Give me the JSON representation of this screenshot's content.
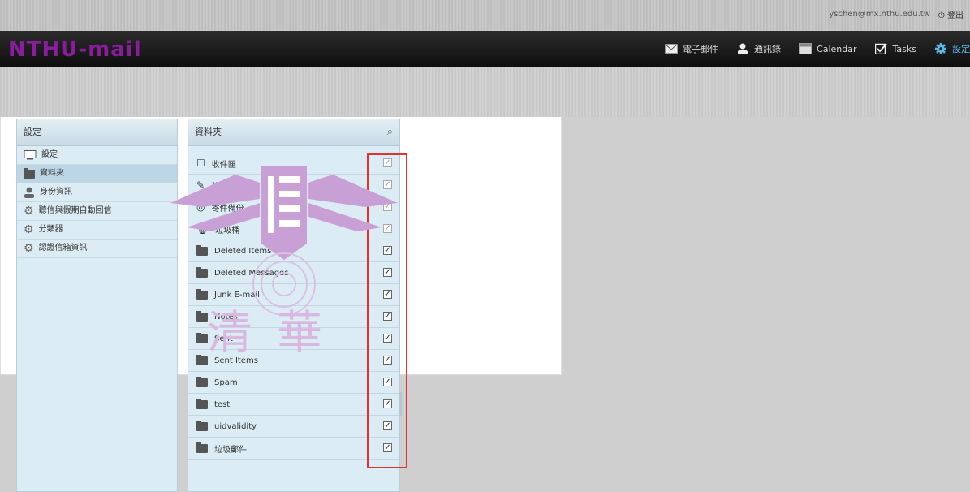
{
  "topstrip": {
    "user_email": "yschen@mx.nthu.edu.tw",
    "logout_label": "登出"
  },
  "header": {
    "logo": "NTHU-mail"
  },
  "nav": [
    {
      "label": "電子郵件",
      "icon": "envelope-icon"
    },
    {
      "label": "通訊錄",
      "icon": "person-icon"
    },
    {
      "label": "Calendar",
      "icon": "calendar-icon"
    },
    {
      "label": "Tasks",
      "icon": "checkbox-icon"
    },
    {
      "label": "設定",
      "icon": "gear-icon"
    }
  ],
  "settings": {
    "title": "設定",
    "items": [
      {
        "label": "設定",
        "icon": "monitor-icon"
      },
      {
        "label": "資料夾",
        "icon": "folder-icon"
      },
      {
        "label": "身份資訊",
        "icon": "person-icon"
      },
      {
        "label": "聽信與假期自動回信",
        "icon": "gear-icon"
      },
      {
        "label": "分類器",
        "icon": "gear-icon"
      },
      {
        "label": "認證信箱資訊",
        "icon": "gear-icon"
      }
    ]
  },
  "folders": {
    "title": "資料夾",
    "items": [
      {
        "label": "收件匣",
        "icon": "inbox-icon",
        "checked": true,
        "locked": true
      },
      {
        "label": "草稿匣",
        "icon": "pencil-icon",
        "checked": true,
        "locked": true
      },
      {
        "label": "寄件備份",
        "icon": "sent-icon",
        "checked": true,
        "locked": true
      },
      {
        "label": "垃圾桶",
        "icon": "trash-icon",
        "checked": true,
        "locked": true
      },
      {
        "label": "Deleted Items",
        "icon": "folder-icon",
        "checked": true,
        "locked": false
      },
      {
        "label": "Deleted Messages",
        "icon": "folder-icon",
        "checked": true,
        "locked": false
      },
      {
        "label": "Junk E-mail",
        "icon": "folder-icon",
        "checked": true,
        "locked": false
      },
      {
        "label": "Notes",
        "icon": "folder-icon",
        "checked": true,
        "locked": false
      },
      {
        "label": "Sent",
        "icon": "folder-icon",
        "checked": true,
        "locked": false
      },
      {
        "label": "Sent Items",
        "icon": "folder-icon",
        "checked": true,
        "locked": false
      },
      {
        "label": "Spam",
        "icon": "folder-icon",
        "checked": true,
        "locked": false
      },
      {
        "label": "test",
        "icon": "folder-icon",
        "checked": true,
        "locked": false
      },
      {
        "label": "uidvalidity",
        "icon": "folder-icon",
        "checked": true,
        "locked": false
      },
      {
        "label": "垃圾郵件",
        "icon": "folder-icon",
        "checked": true,
        "locked": false
      }
    ]
  },
  "content": {
    "seal_text": "清華",
    "seal_logo": "NATIONAL TSING HUA UNIVERSITY"
  },
  "colors": {
    "logo": "#8a1d9c",
    "highlight": "#e53030",
    "seal": "#c9a0d6",
    "active_nav": "#5ab9ea"
  }
}
